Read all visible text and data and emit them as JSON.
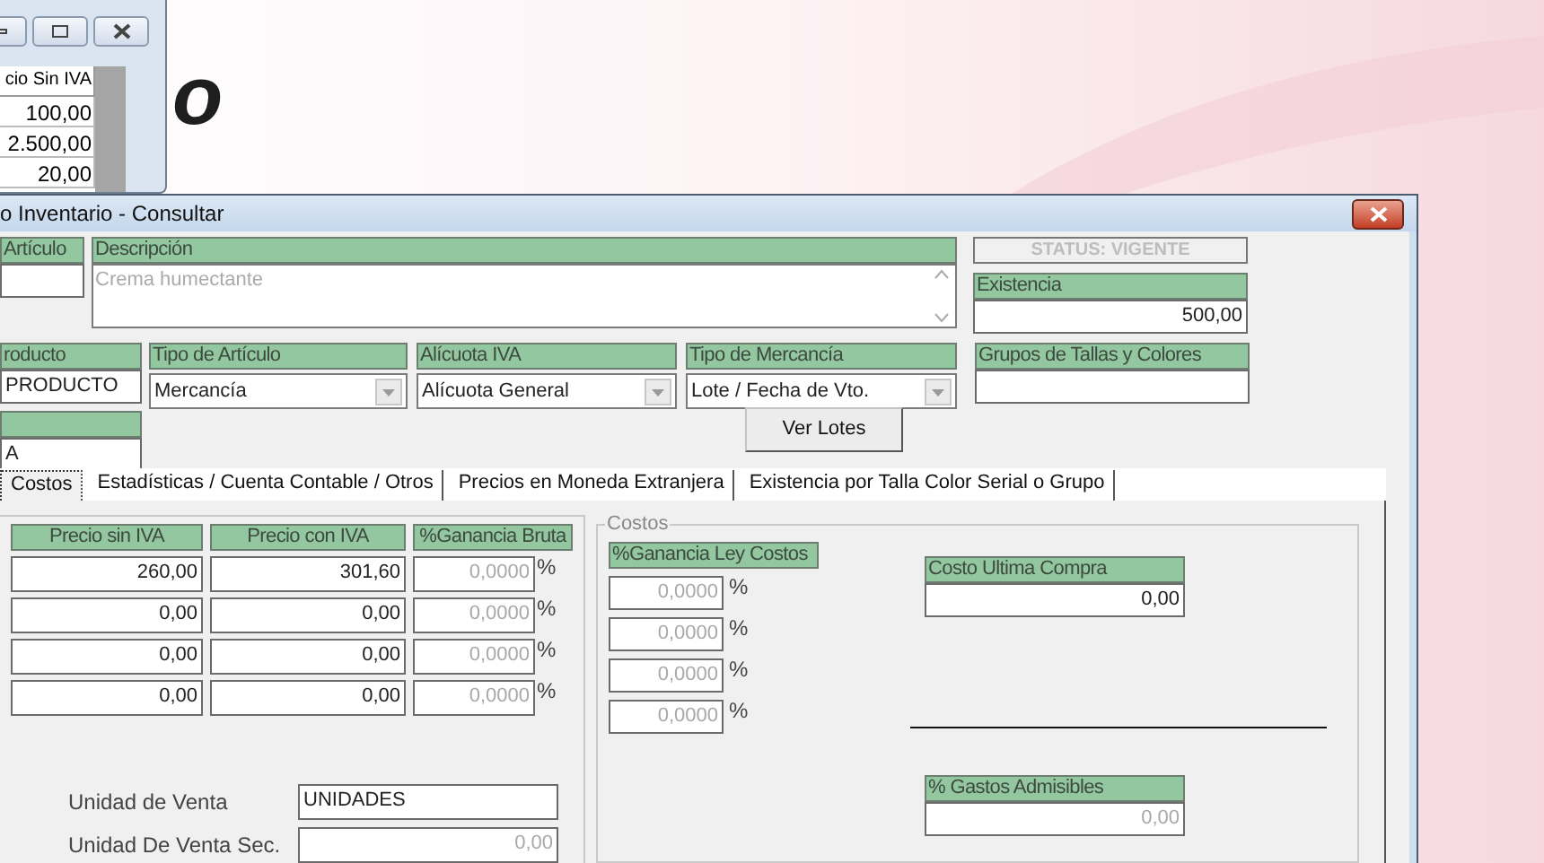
{
  "background_window": {
    "column_header": "cio Sin IVA",
    "cells": [
      "100,00",
      "2.500,00",
      "20,00"
    ]
  },
  "background_title": "o",
  "window": {
    "title": "o Inventario - Consultar"
  },
  "articulo": {
    "label": "Artículo"
  },
  "descripcion": {
    "label": "Descripción",
    "value": "Crema humectante"
  },
  "status": "STATUS: VIGENTE",
  "existencia": {
    "label": "Existencia",
    "value": "500,00"
  },
  "producto": {
    "label": "roducto",
    "value": "PRODUCTO"
  },
  "tipo_articulo": {
    "label": "Tipo de Artículo",
    "value": "Mercancía"
  },
  "alicuota_iva": {
    "label": "Alícuota IVA",
    "value": "Alícuota General"
  },
  "tipo_mercancia": {
    "label": "Tipo de Mercancía",
    "value": "Lote / Fecha de Vto."
  },
  "grupos": {
    "label": "Grupos de Tallas y Colores"
  },
  "field_3": {
    "value": "A"
  },
  "ver_lotes_button": "Ver Lotes",
  "tabs": [
    {
      "label": "Costos",
      "selected": true
    },
    {
      "label": "Estadísticas / Cuenta Contable / Otros",
      "selected": false
    },
    {
      "label": "Precios en Moneda Extranjera",
      "selected": false
    },
    {
      "label": "Existencia por Talla Color  Serial o Grupo",
      "selected": false
    }
  ],
  "prices": {
    "columns": [
      "Precio sin IVA",
      "Precio con IVA",
      "%Ganancia Bruta"
    ],
    "rows": [
      {
        "precio_sin_iva": "260,00",
        "precio_con_iva": "301,60",
        "ganancia": {
          "value": "0,0000",
          "disabled": true
        },
        "unit": "%"
      },
      {
        "precio_sin_iva": "0,00",
        "precio_con_iva": "0,00",
        "ganancia": {
          "value": "0,0000",
          "disabled": true
        },
        "unit": "%"
      },
      {
        "precio_sin_iva": "0,00",
        "precio_con_iva": "0,00",
        "ganancia": {
          "value": "0,0000",
          "disabled": true
        },
        "unit": "%"
      },
      {
        "precio_sin_iva": "0,00",
        "precio_con_iva": "0,00",
        "ganancia": {
          "value": "0,0000",
          "disabled": true
        },
        "unit": "%"
      }
    ]
  },
  "unidad_venta": {
    "label": "Unidad de Venta",
    "value": "UNIDADES",
    "disabled": false
  },
  "unidad_venta_sec": {
    "label": "Unidad De Venta Sec.",
    "value": "0,00",
    "disabled": true
  },
  "costos": {
    "title": "Costos",
    "ganancia_ley": {
      "label": "%Ganancia Ley Costos",
      "rows": [
        {
          "value": "0,0000",
          "disabled": true,
          "unit": "%"
        },
        {
          "value": "0,0000",
          "disabled": true,
          "unit": "%"
        },
        {
          "value": "0,0000",
          "disabled": true,
          "unit": "%"
        },
        {
          "value": "0,0000",
          "disabled": true,
          "unit": "%"
        }
      ]
    },
    "costo_ultima_compra": {
      "label": "Costo Ultima Compra",
      "value": "0,00",
      "disabled": false
    },
    "gastos_admisibles": {
      "label": "% Gastos Admisibles",
      "value": "0,00",
      "disabled": true
    }
  }
}
